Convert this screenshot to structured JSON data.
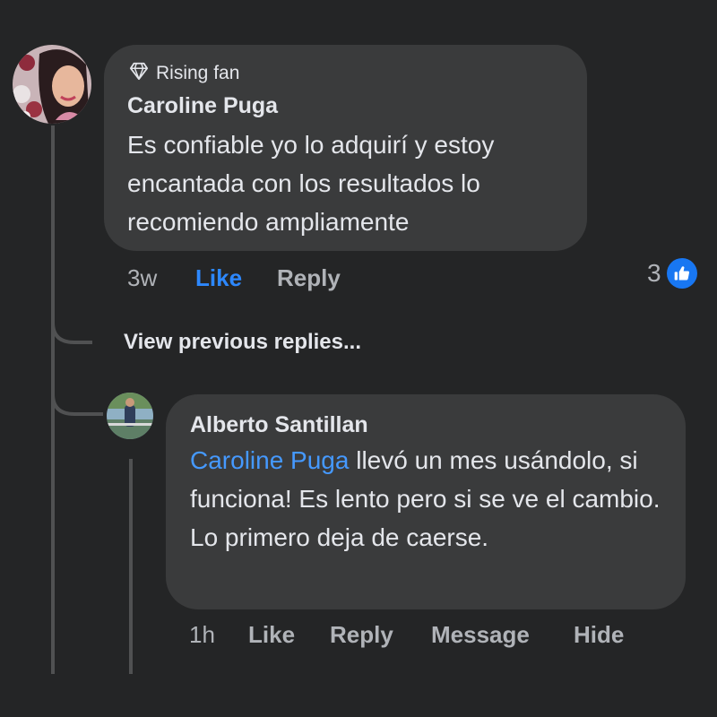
{
  "comment1": {
    "badge_icon": "diamond-icon",
    "badge": "Rising fan",
    "author": "Caroline Puga",
    "text": "Es confiable yo lo adquirí y estoy encantada con los resultados lo recomiendo ampliamente",
    "time": "3w",
    "like_label": "Like",
    "reply_label": "Reply",
    "reaction_count": "3",
    "reaction_icon": "thumbs-up-icon",
    "like_color": "#2d88ff"
  },
  "view_previous": "View previous replies...",
  "reply1": {
    "author": "Alberto Santillan",
    "mention": "Caroline Puga",
    "text": " llevó un mes usándolo, si funciona! Es lento pero si se ve el cambio. Lo primero deja de caerse.",
    "time": "1h",
    "like_label": "Like",
    "reply_label": "Reply",
    "message_label": "Message",
    "hide_label": "Hide",
    "mention_color": "#4599ff"
  }
}
